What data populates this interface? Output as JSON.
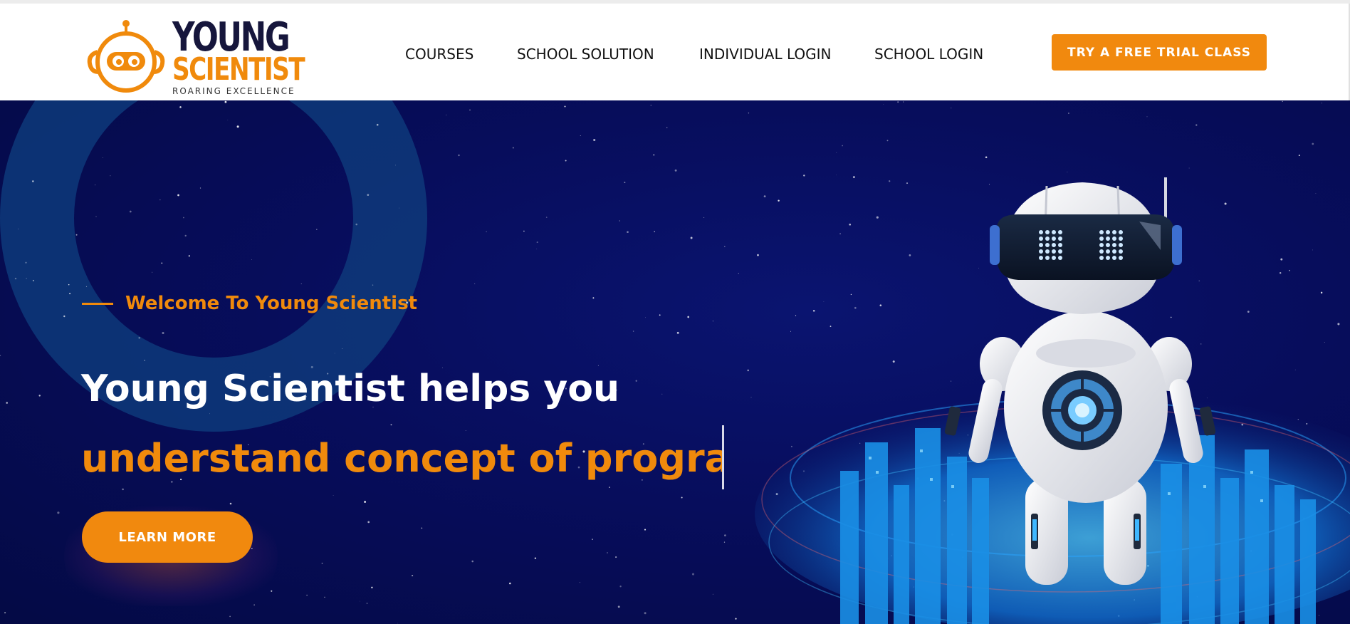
{
  "header": {
    "logo": {
      "line1": "YOUNG",
      "line2": "SCIENTIST",
      "tagline": "ROARING EXCELLENCE"
    },
    "nav": [
      {
        "label": "COURSES"
      },
      {
        "label": "SCHOOL SOLUTION"
      },
      {
        "label": "INDIVIDUAL LOGIN"
      },
      {
        "label": "SCHOOL LOGIN"
      }
    ],
    "cta_label": "TRY A FREE TRIAL CLASS"
  },
  "hero": {
    "welcome": "Welcome To Young Scientist",
    "headline_line1": "Young Scientist helps you",
    "headline_line2": "understand concept of programming",
    "button_label": "LEARN MORE"
  },
  "colors": {
    "accent": "#f1890e",
    "navy": "#070d5c",
    "logo_dark": "#16163c"
  },
  "icons": [
    "robot-logo-icon",
    "robot-illustration",
    "city-illustration"
  ]
}
